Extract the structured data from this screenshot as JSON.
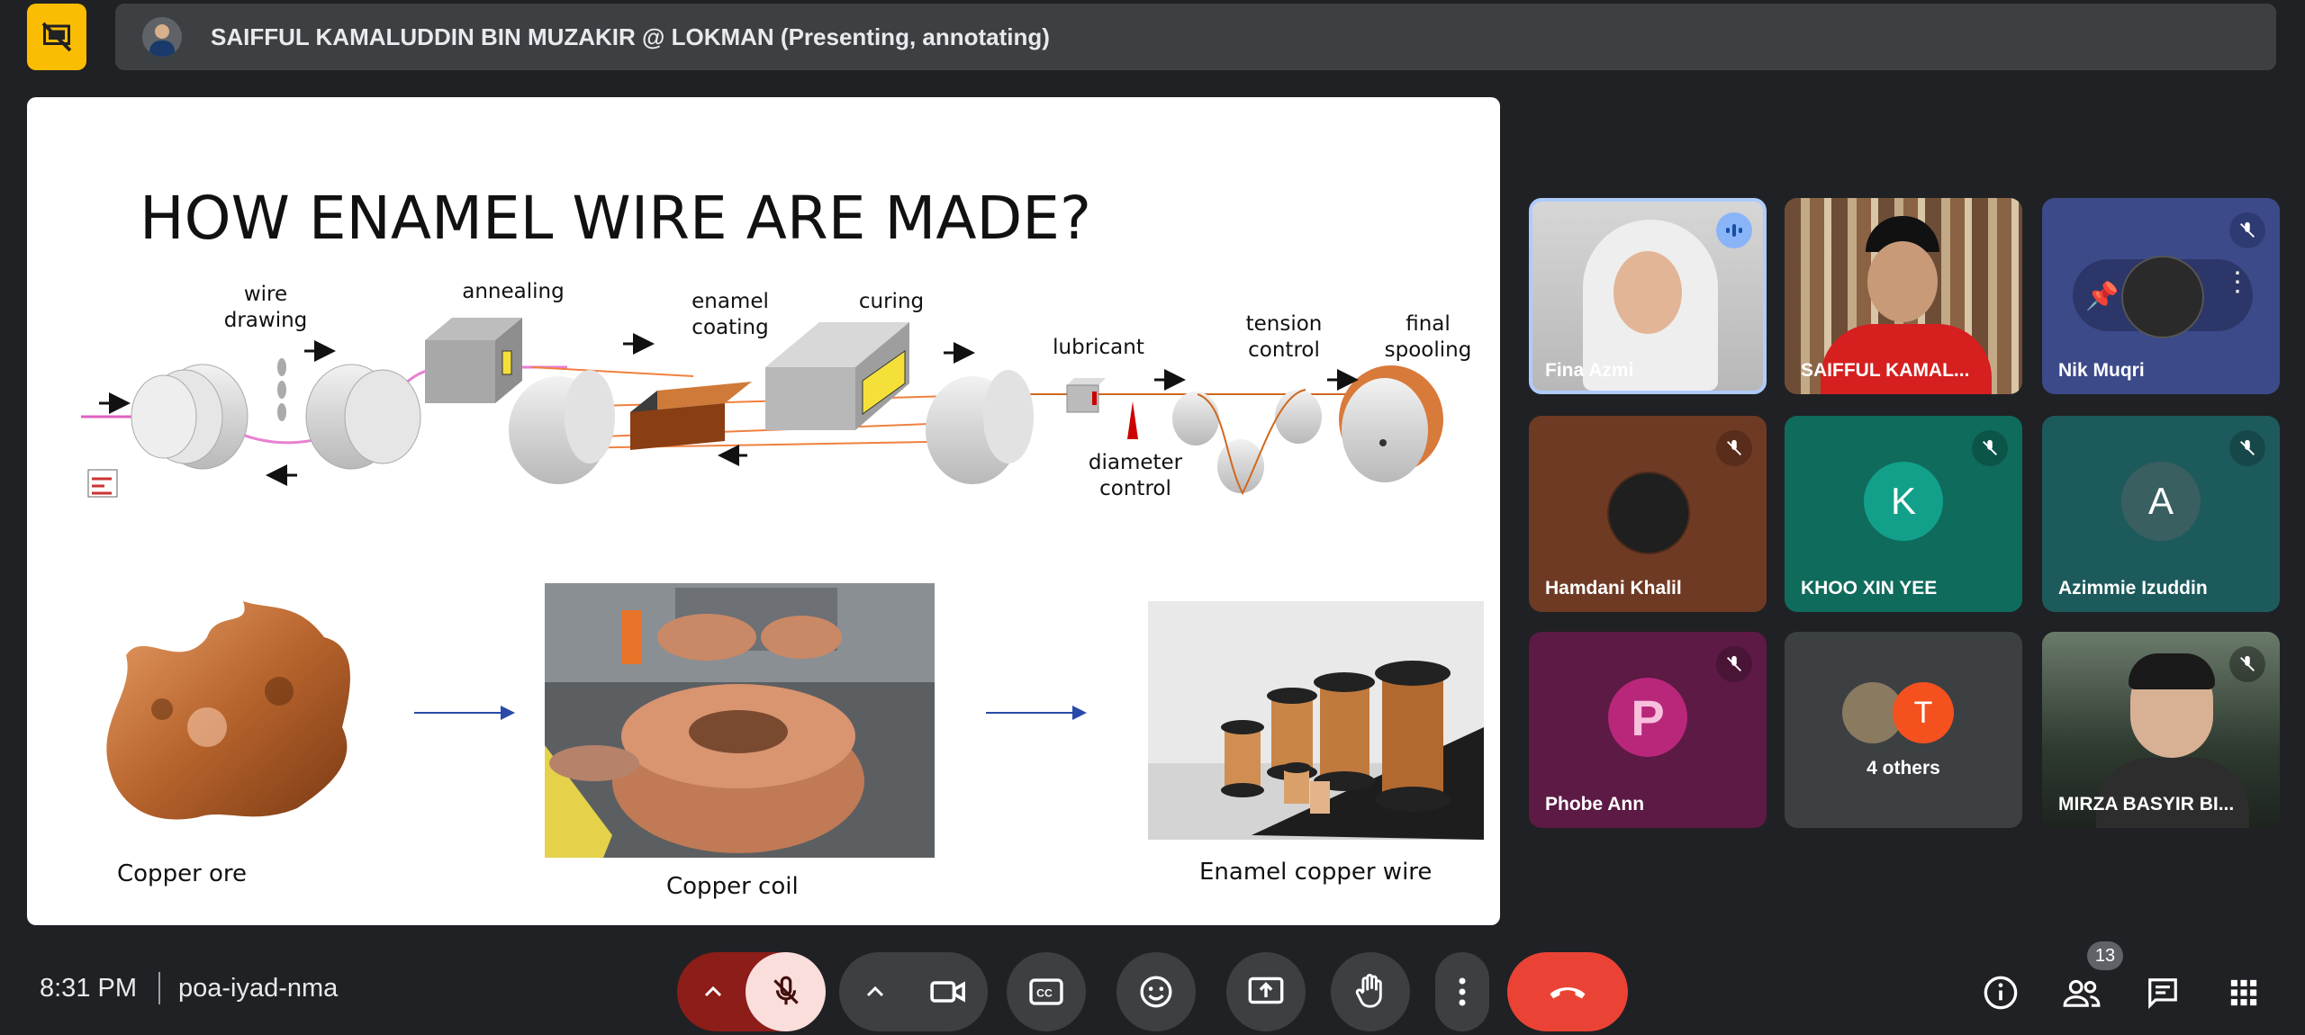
{
  "presenter": {
    "title": "SAIFFUL KAMALUDDIN BIN MUZAKIR @ LOKMAN (Presenting, annotating)"
  },
  "slide": {
    "title": "HOW ENAMEL WIRE ARE MADE?",
    "process_labels": {
      "wire_drawing": "wire drawing",
      "annealing": "annealing",
      "enamel_coating": "enamel coating",
      "curing": "curing",
      "lubricant": "lubricant",
      "diameter_control": "diameter control",
      "tension_control": "tension control",
      "final_spooling": "final spooling"
    },
    "captions": {
      "copper_ore": "Copper ore",
      "copper_coil": "Copper coil",
      "enamel_wire": "Enamel copper wire"
    }
  },
  "participants": [
    {
      "name": "Fina Azmi",
      "state": "speaking"
    },
    {
      "name": "SAIFFUL KAMAL...",
      "state": "presenting"
    },
    {
      "name": "Nik Muqri",
      "state": "muted"
    },
    {
      "name": "Hamdani Khalil",
      "state": "muted"
    },
    {
      "name": "KHOO XIN YEE",
      "initial": "K",
      "state": "muted"
    },
    {
      "name": "Azimmie Izuddin",
      "initial": "A",
      "state": "muted"
    },
    {
      "name": "Phobe Ann",
      "initial": "P",
      "state": "muted"
    },
    {
      "name": "4 others",
      "initial": "T"
    },
    {
      "name": "MIRZA BASYIR BI...",
      "state": "muted"
    }
  ],
  "meeting": {
    "time": "8:31 PM",
    "code": "poa-iyad-nma",
    "participant_count": "13"
  },
  "colors": {
    "end_call": "#ea4335",
    "mic_off_bg": "#f9dedc",
    "stop_presenting": "#fbbc04"
  },
  "icons": [
    "stop-presenting-icon",
    "mic-off-icon",
    "camera-icon",
    "captions-icon",
    "emoji-icon",
    "present-icon",
    "raise-hand-icon",
    "more-options-icon",
    "end-call-icon",
    "info-icon",
    "people-icon",
    "chat-icon",
    "activities-icon"
  ]
}
